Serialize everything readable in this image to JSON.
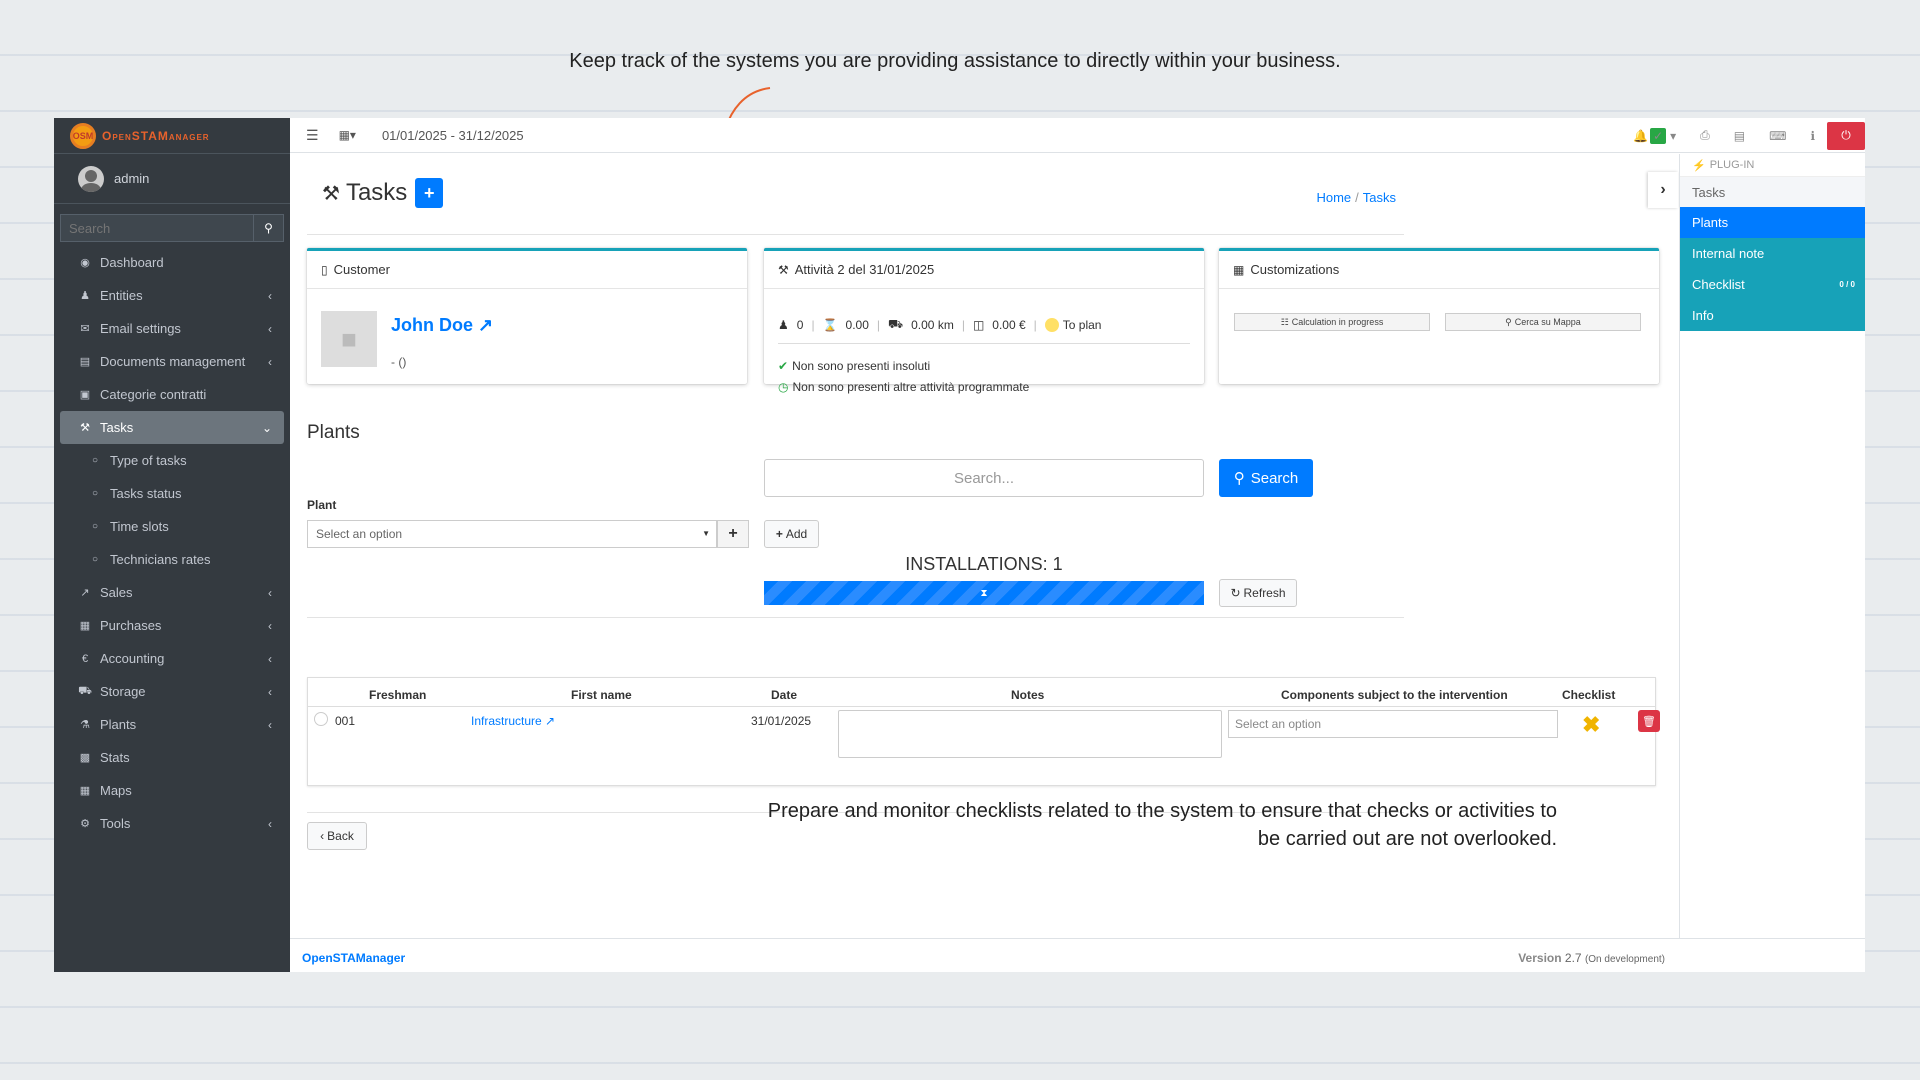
{
  "captions": {
    "top": "Keep track of the systems you are providing assistance to directly within your business.",
    "bottom": "Prepare and monitor checklists related to the system to ensure that checks or activities to be carried out are not overlooked."
  },
  "brand": {
    "name": "OpenSTAManager",
    "logo_text": "OSM"
  },
  "user": {
    "name": "admin"
  },
  "sidebar": {
    "search_placeholder": "Search",
    "items": [
      {
        "label": "Dashboard",
        "icon": "dashboard-icon"
      },
      {
        "label": "Entities",
        "icon": "users-icon"
      },
      {
        "label": "Email settings",
        "icon": "envelope-icon"
      },
      {
        "label": "Documents management",
        "icon": "file-icon"
      },
      {
        "label": "Categorie contratti",
        "icon": "briefcase-icon"
      },
      {
        "label": "Tasks",
        "icon": "wrench-icon"
      },
      {
        "label": "Type of tasks",
        "icon": "circle-icon"
      },
      {
        "label": "Tasks status",
        "icon": "circle-icon"
      },
      {
        "label": "Time slots",
        "icon": "circle-icon"
      },
      {
        "label": "Technicians rates",
        "icon": "circle-icon"
      },
      {
        "label": "Sales",
        "icon": "chart-icon"
      },
      {
        "label": "Purchases",
        "icon": "cart-icon"
      },
      {
        "label": "Accounting",
        "icon": "euro-icon"
      },
      {
        "label": "Storage",
        "icon": "truck-icon"
      },
      {
        "label": "Plants",
        "icon": "sitemap-icon"
      },
      {
        "label": "Stats",
        "icon": "bar-chart-icon"
      },
      {
        "label": "Maps",
        "icon": "map-icon"
      },
      {
        "label": "Tools",
        "icon": "cog-icon"
      }
    ]
  },
  "topbar": {
    "period": "01/01/2025 - 31/12/2025"
  },
  "page": {
    "title": "Tasks",
    "breadcrumb": [
      "Home",
      "Tasks"
    ]
  },
  "customer_card": {
    "header": "Customer",
    "name": "John Doe",
    "sub": "- ()"
  },
  "activity_card": {
    "header": "Attività 2 del 31/01/2025",
    "stats": {
      "people": "0",
      "hours": "0.00",
      "km": "0.00 km",
      "cost": "0.00 €",
      "status": "To plan"
    },
    "note1": "Non sono presenti insoluti",
    "note2": "Non sono presenti altre attività programmate"
  },
  "custom_card": {
    "header": "Customizations",
    "btn1": "Calculation in progress",
    "btn2": "Cerca su Mappa"
  },
  "plants": {
    "title": "Plants",
    "plant_label": "Plant",
    "select_placeholder": "Select an option",
    "search_placeholder": "Search...",
    "search_button": "Search",
    "add_button": "Add",
    "installations": "INSTALLATIONS: 1",
    "progress_label": "⧗",
    "refresh_button": "Refresh"
  },
  "table": {
    "headers": [
      "Freshman",
      "First name",
      "Date",
      "Notes",
      "Components subject to the intervention",
      "Checklist"
    ],
    "rows": [
      {
        "code": "001",
        "name": "Infrastructure",
        "date": "31/01/2025",
        "notes": "",
        "components_placeholder": "Select an option"
      }
    ]
  },
  "back_button": "Back",
  "footer": {
    "brand": "OpenSTAManager",
    "version_label": "Version",
    "version": "2.7",
    "dev": "(On development)"
  },
  "rpanel": {
    "plugin_label": "PLUG-IN",
    "items": [
      "Tasks",
      "Plants",
      "Internal note",
      "Checklist",
      "Info"
    ],
    "checklist_badge": "0 / 0"
  },
  "colors": {
    "primary": "#007bff",
    "info": "#17a2b8",
    "danger": "#dc3545",
    "sidebar": "#343a40",
    "annotation": "#e8622c"
  }
}
